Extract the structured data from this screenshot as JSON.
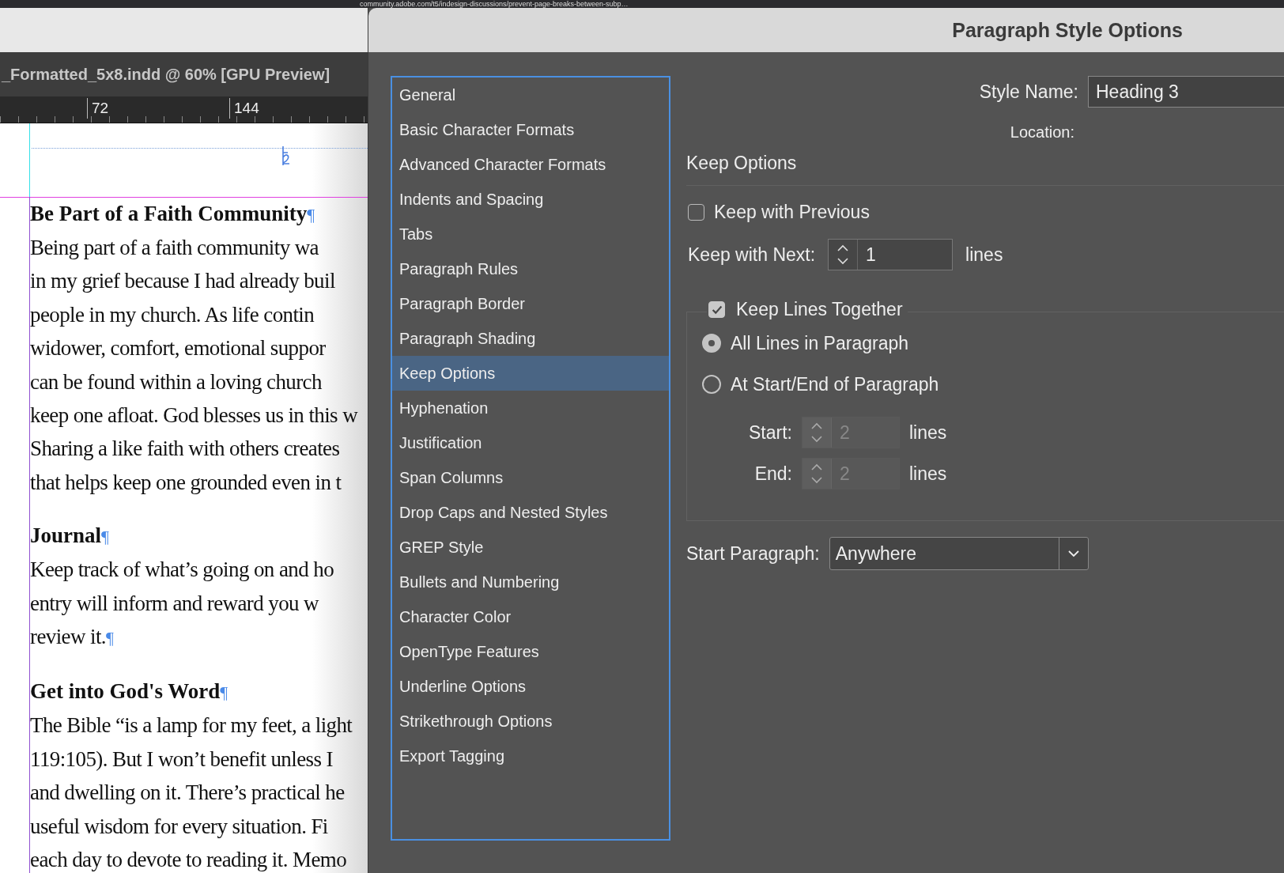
{
  "browser": {
    "url": "community.adobe.com/t5/indesign-discussions/prevent-page-breaks-between-subp…"
  },
  "document": {
    "tab_title": "_Formatted_5x8.indd @ 60% [GPU Preview]",
    "ruler_labels": [
      "72",
      "144"
    ],
    "paragraphs": [
      {
        "kind": "heading",
        "lines": [
          "Be Part of a Faith Community"
        ],
        "end_mark": "¶"
      },
      {
        "kind": "body",
        "lines": [
          "Being part of a faith community wa",
          "in my grief because I had already buil",
          "people in my church. As life contin",
          "widower, comfort, emotional suppor",
          "can be found within a loving church",
          "keep one afloat. God blesses us in this w",
          "Sharing a like faith with others creates",
          "that helps keep one grounded even in t"
        ]
      },
      {
        "kind": "heading",
        "lines": [
          "Journal"
        ],
        "end_mark": "¶"
      },
      {
        "kind": "body",
        "lines": [
          "Keep track of what’s going on and ho",
          "entry will inform and reward you w",
          "review it."
        ],
        "end_mark": "¶"
      },
      {
        "kind": "heading",
        "lines": [
          "Get into God's Word"
        ],
        "end_mark": "¶"
      },
      {
        "kind": "body",
        "lines": [
          "The Bible “is a lamp for my feet, a light",
          "119:105). But I won’t benefit unless I",
          "and dwelling on it. There’s practical he",
          "useful wisdom for every situation. Fi",
          "each day to devote to reading it. Memo"
        ]
      }
    ]
  },
  "dialog": {
    "title": "Paragraph Style Options",
    "categories": [
      {
        "label": "General",
        "selected": false
      },
      {
        "label": "Basic Character Formats",
        "selected": false
      },
      {
        "label": "Advanced Character Formats",
        "selected": false
      },
      {
        "label": "Indents and Spacing",
        "selected": false
      },
      {
        "label": "Tabs",
        "selected": false
      },
      {
        "label": "Paragraph Rules",
        "selected": false
      },
      {
        "label": "Paragraph Border",
        "selected": false
      },
      {
        "label": "Paragraph Shading",
        "selected": false
      },
      {
        "label": "Keep Options",
        "selected": true
      },
      {
        "label": "Hyphenation",
        "selected": false
      },
      {
        "label": "Justification",
        "selected": false
      },
      {
        "label": "Span Columns",
        "selected": false
      },
      {
        "label": "Drop Caps and Nested Styles",
        "selected": false
      },
      {
        "label": "GREP Style",
        "selected": false
      },
      {
        "label": "Bullets and Numbering",
        "selected": false
      },
      {
        "label": "Character Color",
        "selected": false
      },
      {
        "label": "OpenType Features",
        "selected": false
      },
      {
        "label": "Underline Options",
        "selected": false
      },
      {
        "label": "Strikethrough Options",
        "selected": false
      },
      {
        "label": "Export Tagging",
        "selected": false
      }
    ],
    "style_name": {
      "label": "Style Name:",
      "value": "Heading 3"
    },
    "location": {
      "label": "Location:"
    },
    "section_title": "Keep Options",
    "keep_with_previous": {
      "label": "Keep with Previous",
      "checked": false
    },
    "keep_with_next": {
      "label": "Keep with Next:",
      "value": "1",
      "unit": "lines"
    },
    "keep_lines_together": {
      "label": "Keep Lines Together",
      "checked": true
    },
    "options": [
      {
        "label": "All Lines in Paragraph",
        "selected": true
      },
      {
        "label": "At Start/End of Paragraph",
        "selected": false
      }
    ],
    "line_fields": [
      {
        "label": "Start:",
        "value": "2",
        "unit": "lines",
        "disabled": true
      },
      {
        "label": "End:",
        "value": "2",
        "unit": "lines",
        "disabled": true
      }
    ],
    "start_paragraph": {
      "label": "Start Paragraph:",
      "value": "Anywhere"
    }
  }
}
